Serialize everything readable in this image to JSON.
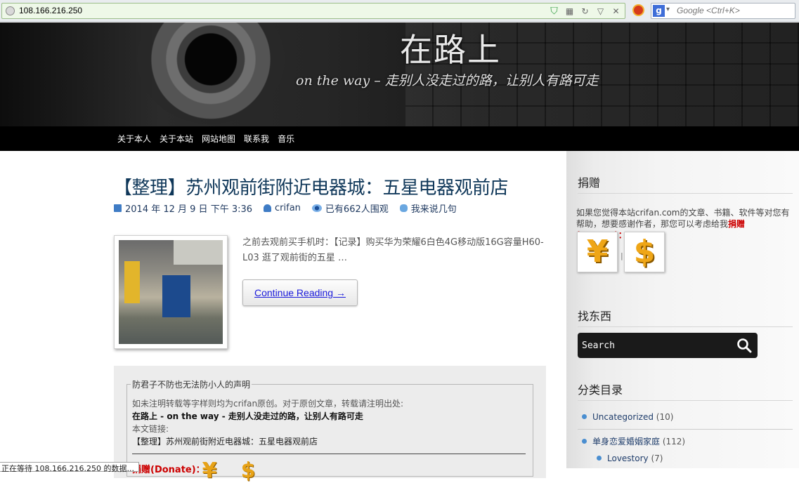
{
  "browser": {
    "url": "108.166.216.250",
    "search_placeholder": "Google <Ctrl+K>",
    "search_engine_letter": "g",
    "status_text": "正在等待 108.166.216.250 的数据..."
  },
  "header": {
    "title": "在路上",
    "tagline": "on the way – 走别人没走过的路，让别人有路可走"
  },
  "nav": {
    "items": [
      "关于本人",
      "关于本站",
      "网站地图",
      "联系我",
      "音乐"
    ]
  },
  "post": {
    "title": "【整理】苏州观前街附近电器城：五星电器观前店",
    "date": "2014 年 12 月 9 日 下午 3:36",
    "author": "crifan",
    "views": "已有662人围观",
    "comments": "我来说几句",
    "excerpt": "之前去观前买手机时：【记录】购买华为荣耀6白色4G移动版16G容量H60-L03 逛了观前街的五星 …",
    "continue_label": "Continue Reading →"
  },
  "statement": {
    "legend": "防君子不防也无法防小人的声明",
    "line1": "如未注明转载等字样则均为crifan原创。对于原创文章，转载请注明出处:",
    "line2": "在路上 - on the way - 走别人没走过的路，让别人有路可走",
    "line3": "本文链接:",
    "line4": "【整理】苏州观前街附近电器城：五星电器观前店",
    "donate": "捐赠(Donate)："
  },
  "sidebar": {
    "donate_title": "捐赠",
    "donate_text": "如果您觉得本站crifan.com的文章、书籍、软件等对您有帮助，想要感谢作者，那您可以考虑给我",
    "donate_link": "捐赠(Donate)：",
    "yuan_symbol": "¥",
    "dollar_symbol": "$",
    "separator": "|",
    "search_title": "找东西",
    "search_placeholder": "Search",
    "categories_title": "分类目录",
    "categories": [
      {
        "name": "Uncategorized",
        "count": "(10)"
      },
      {
        "name": "单身恋爱婚姻家庭",
        "count": "(112)"
      },
      {
        "name": "Lovestory",
        "count": "(7)"
      }
    ]
  }
}
